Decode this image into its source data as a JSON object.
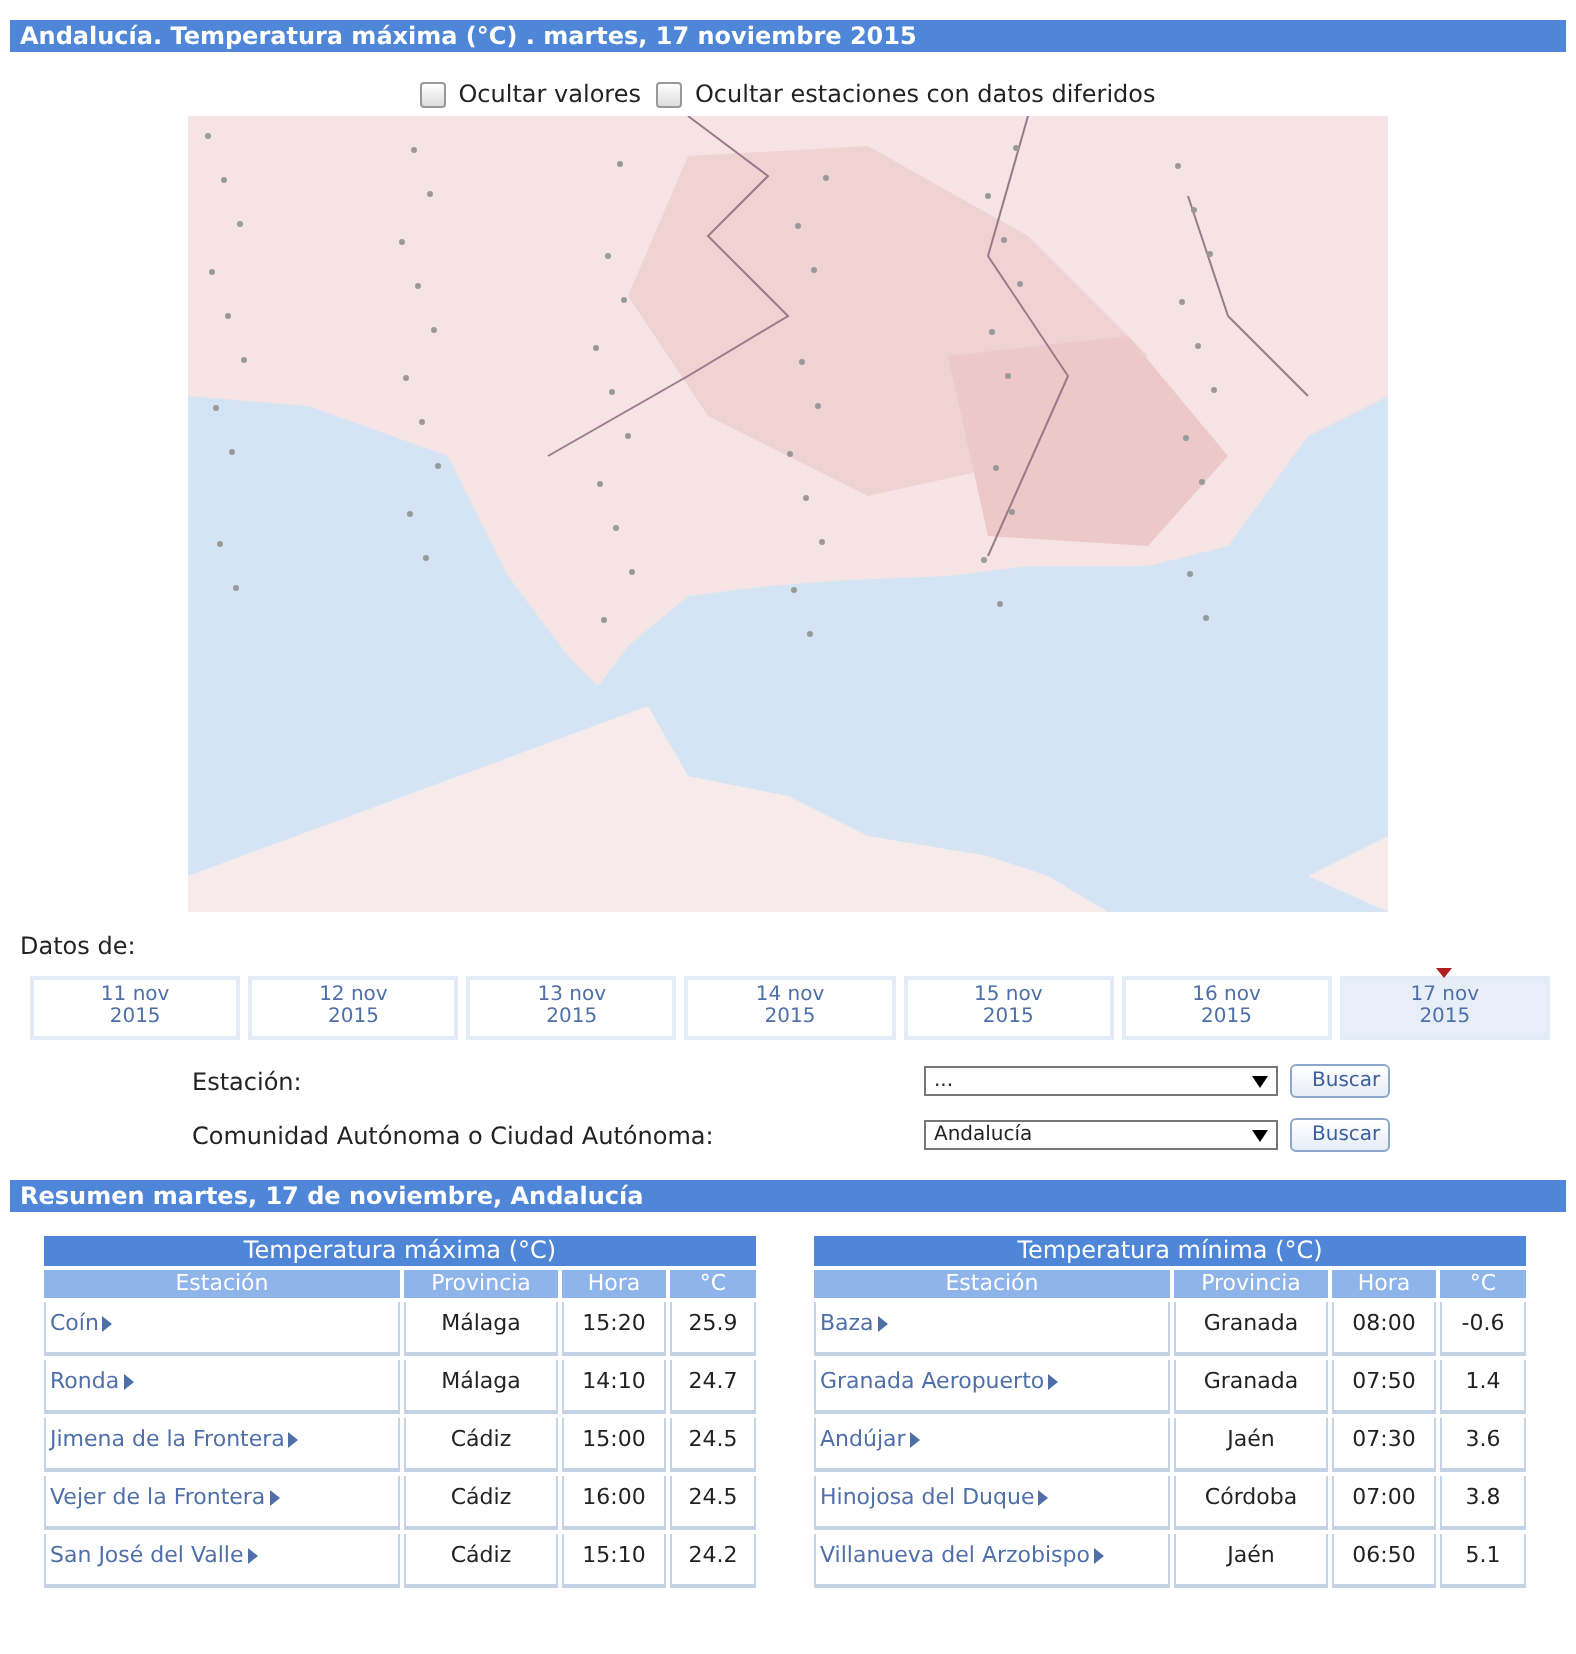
{
  "header": {
    "title": "Andalucía. Temperatura máxima (°C) . martes, 17 noviembre 2015"
  },
  "options": [
    {
      "label": "Ocultar valores",
      "checked": false
    },
    {
      "label": "Ocultar estaciones con datos diferidos",
      "checked": false
    }
  ],
  "dates_label": "Datos de:",
  "dates": [
    {
      "day": "11 nov",
      "year": "2015",
      "selected": false
    },
    {
      "day": "12 nov",
      "year": "2015",
      "selected": false
    },
    {
      "day": "13 nov",
      "year": "2015",
      "selected": false
    },
    {
      "day": "14 nov",
      "year": "2015",
      "selected": false
    },
    {
      "day": "15 nov",
      "year": "2015",
      "selected": false
    },
    {
      "day": "16 nov",
      "year": "2015",
      "selected": false
    },
    {
      "day": "17 nov",
      "year": "2015",
      "selected": true
    }
  ],
  "filters": [
    {
      "label": "Estación:",
      "value": "...",
      "button": "Buscar"
    },
    {
      "label": "Comunidad Autónoma o Ciudad Autónoma:",
      "value": "Andalucía",
      "button": "Buscar"
    }
  ],
  "summary": {
    "title": "Resumen martes, 17 de noviembre, Andalucía"
  },
  "tables": [
    {
      "title": "Temperatura máxima (°C)",
      "columns": [
        "Estación",
        "Provincia",
        "Hora",
        "°C"
      ],
      "rows": [
        [
          "Coín",
          "Málaga",
          "15:20",
          "25.9"
        ],
        [
          "Ronda",
          "Málaga",
          "14:10",
          "24.7"
        ],
        [
          "Jimena de la Frontera",
          "Cádiz",
          "15:00",
          "24.5"
        ],
        [
          "Vejer de la Frontera",
          "Cádiz",
          "16:00",
          "24.5"
        ],
        [
          "San José del Valle",
          "Cádiz",
          "15:10",
          "24.2"
        ]
      ]
    },
    {
      "title": "Temperatura mínima (°C)",
      "columns": [
        "Estación",
        "Provincia",
        "Hora",
        "°C"
      ],
      "rows": [
        [
          "Baza",
          "Granada",
          "08:00",
          "-0.6"
        ],
        [
          "Granada Aeropuerto",
          "Granada",
          "07:50",
          "1.4"
        ],
        [
          "Andújar",
          "Jaén",
          "07:30",
          "3.6"
        ],
        [
          "Hinojosa del Duque",
          "Córdoba",
          "07:00",
          "3.8"
        ],
        [
          "Villanueva del Arzobispo",
          "Jaén",
          "06:50",
          "5.1"
        ]
      ]
    }
  ]
}
